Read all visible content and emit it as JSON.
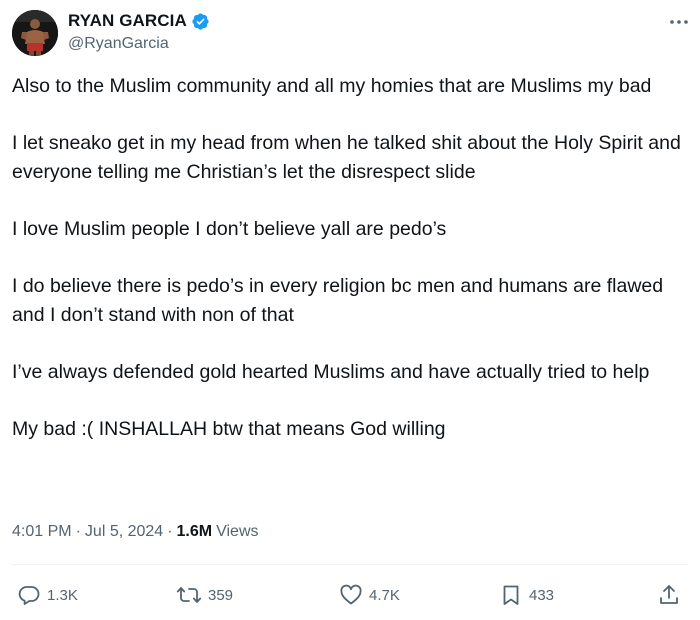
{
  "author": {
    "display_name": "RYAN GARCIA",
    "handle": "@RyanGarcia",
    "verified": true
  },
  "tweet": {
    "paragraphs": [
      "Also to the Muslim community and all my homies that are Muslims my bad",
      "I let sneako get in my head from when he talked shit about the Holy Spirit and everyone telling me Christian’s let the disrespect slide",
      "I love Muslim people I don’t believe yall are pedo’s",
      "I do believe there is pedo’s in every religion bc men and humans are flawed and I don’t stand with non of that",
      "I’ve always defended gold hearted Muslims and have actually tried to help",
      "My bad :( INSHALLAH btw that means God willing"
    ],
    "time": "4:01 PM",
    "date": "Jul 5, 2024",
    "views_count": "1.6M",
    "views_label": "Views"
  },
  "actions": {
    "replies": "1.3K",
    "reposts": "359",
    "likes": "4.7K",
    "bookmarks": "433"
  },
  "colors": {
    "verified": "#1d9bf0",
    "text_secondary": "#536471",
    "text_primary": "#0f1419"
  }
}
